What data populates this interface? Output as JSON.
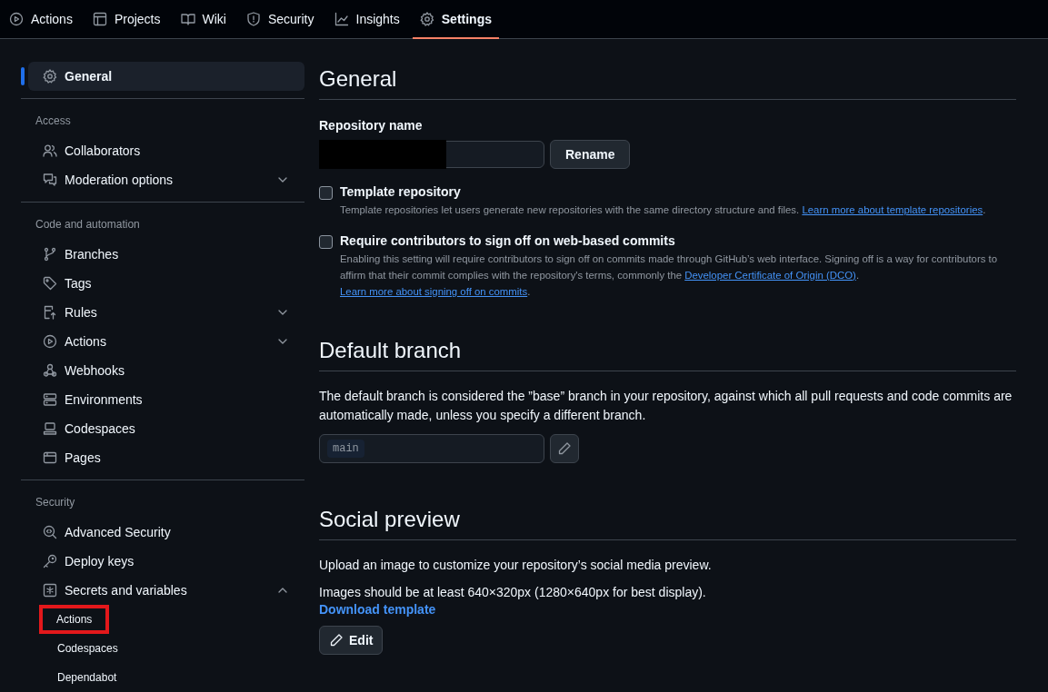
{
  "top_nav": [
    {
      "label": "Actions",
      "selected": false
    },
    {
      "label": "Projects",
      "selected": false
    },
    {
      "label": "Wiki",
      "selected": false
    },
    {
      "label": "Security",
      "selected": false
    },
    {
      "label": "Insights",
      "selected": false
    },
    {
      "label": "Settings",
      "selected": true
    }
  ],
  "sidebar": {
    "sections": [
      {
        "items": [
          {
            "label": "General",
            "selected": true
          }
        ]
      },
      {
        "heading": "Access",
        "items": [
          {
            "label": "Collaborators",
            "selected": false
          },
          {
            "label": "Moderation options",
            "selected": false,
            "expanded": false
          }
        ]
      },
      {
        "heading": "Code and automation",
        "items": [
          {
            "label": "Branches",
            "selected": false
          },
          {
            "label": "Tags",
            "selected": false
          },
          {
            "label": "Rules",
            "selected": false,
            "expanded": false
          },
          {
            "label": "Actions",
            "selected": false,
            "expanded": false
          },
          {
            "label": "Webhooks",
            "selected": false
          },
          {
            "label": "Environments",
            "selected": false
          },
          {
            "label": "Codespaces",
            "selected": false
          },
          {
            "label": "Pages",
            "selected": false
          }
        ]
      },
      {
        "heading": "Security",
        "items": [
          {
            "label": "Advanced Security",
            "selected": false
          },
          {
            "label": "Deploy keys",
            "selected": false
          },
          {
            "label": "Secrets and variables",
            "selected": false,
            "expanded": true,
            "children": [
              {
                "label": "Actions",
                "selected": false,
                "highlighted": true
              },
              {
                "label": "Codespaces",
                "selected": false,
                "highlighted": false
              },
              {
                "label": "Dependabot",
                "selected": false,
                "highlighted": false
              }
            ]
          }
        ]
      }
    ]
  },
  "general": {
    "title": "General",
    "repository_name": {
      "label": "Repository name",
      "redacted": true,
      "button": "Rename"
    },
    "options": [
      {
        "label": "Template repository",
        "checked": false,
        "description": [
          {
            "kind": "text",
            "text": "Template repositories let users generate new repositories with the same directory structure and files. "
          },
          {
            "kind": "link",
            "text": "Learn more about template repositories"
          },
          {
            "kind": "text",
            "text": "."
          }
        ]
      },
      {
        "label": "Require contributors to sign off on web-based commits",
        "checked": false,
        "description": [
          {
            "kind": "text",
            "text": "Enabling this setting will require contributors to sign off on commits made through GitHub’s web interface. Signing off is a way for contributors to affirm that their commit complies with the repository's terms, commonly the "
          },
          {
            "kind": "link",
            "text": "Developer Certificate of Origin (DCO)"
          },
          {
            "kind": "text",
            "text": ". "
          },
          {
            "kind": "link",
            "text": "Learn more about signing off on commits"
          },
          {
            "kind": "text",
            "text": "."
          }
        ]
      }
    ]
  },
  "default_branch": {
    "title": "Default branch",
    "description": "The default branch is considered the ”base” branch in your repository, against which all pull requests and code commits are automatically made, unless you specify a different branch.",
    "branch": "main"
  },
  "social_preview": {
    "title": "Social preview",
    "paragraphs": [
      "Upload an image to customize your repository’s social media preview.",
      "Images should be at least 640×320px (1280×640px for best display)."
    ],
    "link": "Download template",
    "button": "Edit"
  }
}
